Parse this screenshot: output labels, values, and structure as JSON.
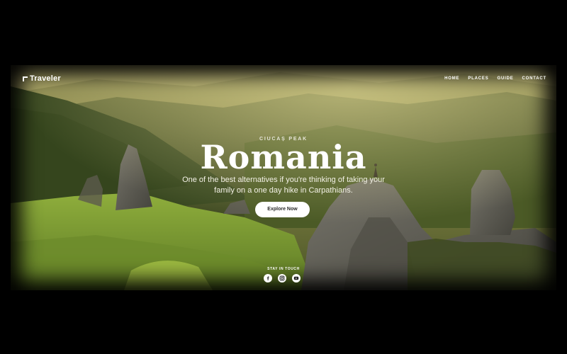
{
  "brand": {
    "name": "Traveler"
  },
  "nav": {
    "items": [
      "HOME",
      "PLACES",
      "GUIDE",
      "CONTACT"
    ]
  },
  "hero": {
    "eyebrow": "CIUCAȘ PEAK",
    "title": "Romania",
    "subtitle": "One of the best alternatives if you're thinking of taking your family on a one day hike in Carpathians.",
    "cta_label": "Explore Now"
  },
  "footer": {
    "stay_label": "STAY IN TOUCH",
    "socials": [
      "facebook-icon",
      "instagram-icon",
      "youtube-icon"
    ]
  },
  "colors": {
    "sky_haze": "#c9c070",
    "forest": "#3f5424",
    "meadow": "#86a33a",
    "rock": "#5f5d55",
    "backdrop": "#000000"
  }
}
